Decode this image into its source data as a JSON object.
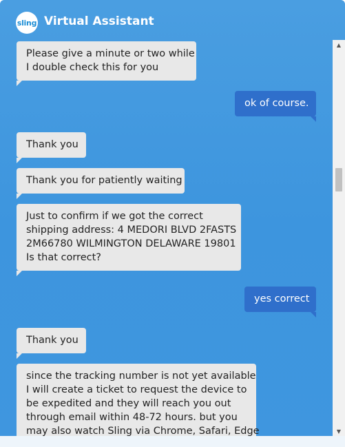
{
  "header": {
    "logo_text": "sling",
    "title": "Virtual Assistant"
  },
  "colors": {
    "panel": "#4a9ee1",
    "bot_bubble": "#e8e8e8",
    "user_bubble": "#2f6fcb"
  },
  "messages": [
    {
      "from": "bot",
      "lines": [
        "Please give a minute or two while",
        "I double check this for you"
      ]
    },
    {
      "from": "user",
      "lines": [
        "ok of course."
      ]
    },
    {
      "from": "bot",
      "lines": [
        "Thank you"
      ]
    },
    {
      "from": "bot",
      "lines": [
        "Thank you for patiently waiting"
      ]
    },
    {
      "from": "bot",
      "lines": [
        "Just to confirm if we got the correct",
        "shipping address: 4 MEDORI BLVD 2FASTS",
        "2M66780 WILMINGTON DELAWARE 19801",
        "Is that correct?"
      ]
    },
    {
      "from": "user",
      "lines": [
        "yes correct"
      ]
    },
    {
      "from": "bot",
      "lines": [
        "Thank you"
      ]
    },
    {
      "from": "bot",
      "lines": [
        "since the tracking number is not yet available",
        "I will create a ticket to request the device to",
        "be expedited and they will reach you out",
        "through email within 48-72 hours. but you",
        "may also watch Sling via Chrome, Safari, Edge"
      ]
    }
  ],
  "scrollbar": {
    "up_icon": "triangle-up-icon",
    "down_icon": "triangle-down-icon"
  }
}
